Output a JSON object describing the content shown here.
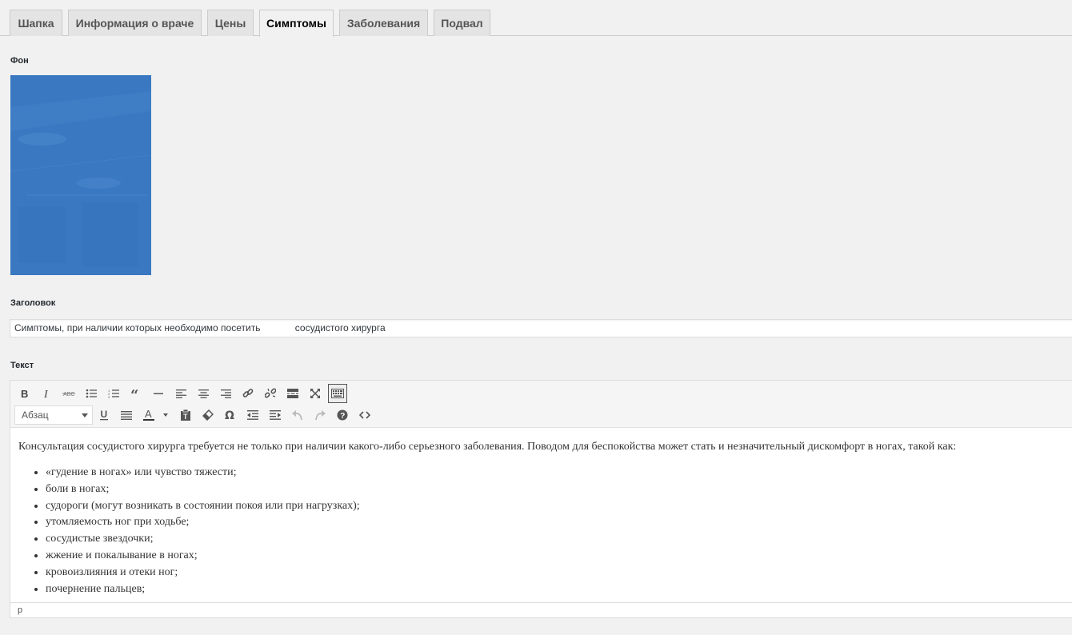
{
  "tabs": [
    {
      "label": "Шапка",
      "active": false
    },
    {
      "label": "Информация о враче",
      "active": false
    },
    {
      "label": "Цены",
      "active": false
    },
    {
      "label": "Симптомы",
      "active": true
    },
    {
      "label": "Заболевания",
      "active": false
    },
    {
      "label": "Подвал",
      "active": false
    }
  ],
  "fields": {
    "background_label": "Фон",
    "title_label": "Заголовок",
    "title_value": "Симптомы, при наличии которых необходимо посетить             сосудистого хирурга",
    "text_label": "Текст"
  },
  "editor": {
    "format_select": "Абзац",
    "toolbar_row1_icons": [
      "bold-icon",
      "italic-icon",
      "strikethrough-icon",
      "bullet-list-icon",
      "numbered-list-icon",
      "blockquote-icon",
      "horizontal-rule-icon",
      "align-left-icon",
      "align-center-icon",
      "align-right-icon",
      "link-icon",
      "unlink-icon",
      "read-more-icon",
      "fullscreen-icon",
      "toolbar-toggle-icon"
    ],
    "toolbar_row2_icons": [
      "underline-icon",
      "justify-icon",
      "text-color-icon",
      "paste-text-icon",
      "clear-formatting-icon",
      "special-character-icon",
      "outdent-icon",
      "indent-icon",
      "undo-icon",
      "redo-icon",
      "help-icon",
      "code-icon"
    ],
    "paragraph": "Консультация сосудистого хирурга требуется не только при наличии какого-либо серьезного заболевания. Поводом для беспокойства может стать и незначительный дискомфорт в ногах, такой как:",
    "list": [
      "«гудение в ногах» или чувство тяжести;",
      "боли в ногах;",
      "судороги (могут возникать в состоянии покоя или при нагрузках);",
      "утомляемость ног при ходьбе;",
      "сосудистые звездочки;",
      "жжение и покалывание в ногах;",
      "кровоизлияния и отеки ног;",
      "почернение пальцев;"
    ],
    "status_path": "p"
  },
  "colors": {
    "background": "#f1f1f1",
    "image_blue": "#3a78c2",
    "tab_inactive": "#e4e4e4"
  }
}
